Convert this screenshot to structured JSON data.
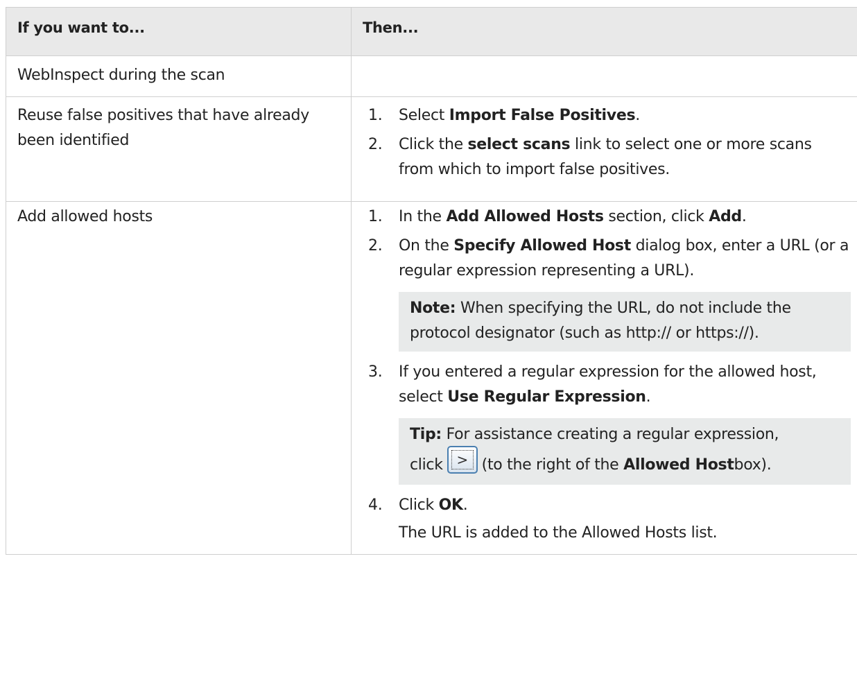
{
  "table": {
    "headers": [
      "If you want to...",
      "Then..."
    ],
    "row1": {
      "left": "WebInspect during the scan"
    },
    "row2": {
      "left": "Reuse false positives that have already been identified",
      "steps": [
        {
          "num": "1.",
          "pre": "Select ",
          "bold": "Import False Positives",
          "post": "."
        },
        {
          "num": "2.",
          "pre": "Click the ",
          "bold": "select scans",
          "post": " link to select one or more scans from which to import false positives."
        }
      ]
    },
    "row3": {
      "left": "Add allowed hosts",
      "step1": {
        "num": "1.",
        "pre": "In the ",
        "bold1": "Add Allowed Hosts",
        "mid": " section, click ",
        "bold2": "Add",
        "post": "."
      },
      "step2": {
        "num": "2.",
        "pre": "On the ",
        "bold": "Specify Allowed Host",
        "post": " dialog box, enter a URL (or a regular expression representing a URL)."
      },
      "note": {
        "label": "Note:",
        "text": " When specifying the URL, do not include the protocol designator (such as http:// or https://)."
      },
      "step3": {
        "num": "3.",
        "pre": "If you entered a regular expression for the allowed host, select ",
        "bold": "Use Regular Expression",
        "post": "."
      },
      "tip": {
        "label": "Tip:",
        "line1": " For assistance creating a regular expression,",
        "click": "click",
        "button_glyph": ">",
        "after": " (to the right of the ",
        "bold": "Allowed Host",
        "end": " box)."
      },
      "step4": {
        "num": "4.",
        "pre": "Click ",
        "bold": "OK",
        "post": "."
      },
      "result": "The URL is added to the Allowed Hosts list."
    }
  }
}
